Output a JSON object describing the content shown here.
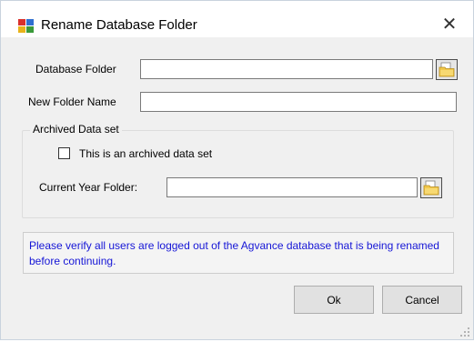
{
  "window": {
    "title": "Rename Database Folder",
    "app_icon": "database-folder-icon",
    "close_glyph": "✕"
  },
  "form": {
    "database_folder_label": "Database Folder",
    "database_folder_value": "",
    "new_folder_name_label": "New Folder Name",
    "new_folder_name_value": "",
    "archived_group_label": "Archived Data set",
    "archived_checkbox_label": "This is an archived data set",
    "archived_checked": false,
    "current_year_folder_label": "Current Year Folder:",
    "current_year_folder_value": "",
    "browse_icon": "folder-browse-icon"
  },
  "notice": {
    "text": "Please verify all users are logged out of the Agvance database that is being renamed before continuing.",
    "color": "#1515d6"
  },
  "buttons": {
    "ok_label": "Ok",
    "cancel_label": "Cancel"
  }
}
